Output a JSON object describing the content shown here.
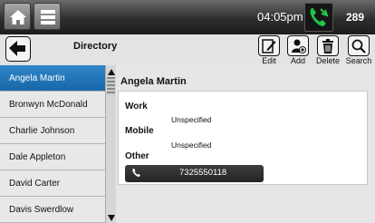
{
  "status_bar": {
    "time": "04:05pm",
    "count": "289",
    "accent": "#22c44a"
  },
  "header": {
    "title": "Directory",
    "tools": {
      "edit": "Edit",
      "add": "Add",
      "delete": "Delete",
      "search": "Search"
    }
  },
  "contacts": [
    "Angela Martin",
    "Bronwyn McDonald",
    "Charlie Johnson",
    "Dale Appleton",
    "David Carter",
    "Davis Swerdlow"
  ],
  "selected_contact": {
    "name": "Angela Martin",
    "sections": {
      "work": {
        "label": "Work",
        "value": "Unspecified"
      },
      "mobile": {
        "label": "Mobile",
        "value": "Unspecified"
      },
      "other": {
        "label": "Other",
        "value": "7325550118"
      }
    }
  },
  "colors": {
    "selection": "#1f74b8",
    "number_button": "#2f2f2f"
  },
  "icons": [
    "home-icon",
    "menu-icon",
    "phone-icon",
    "back-arrow-icon",
    "edit-icon",
    "add-user-icon",
    "trash-icon",
    "search-icon",
    "scroll-up-icon",
    "scroll-down-icon"
  ]
}
